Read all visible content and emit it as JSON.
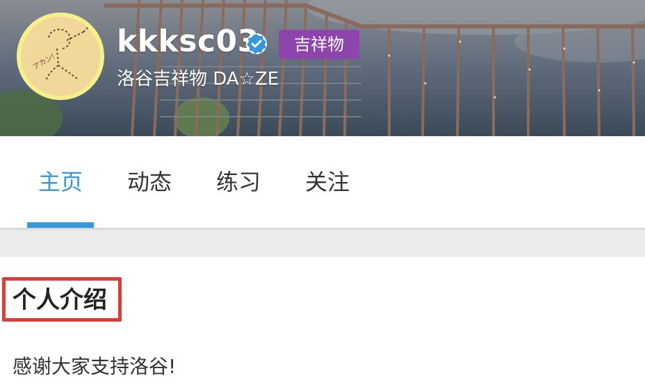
{
  "profile": {
    "username": "kkksc03",
    "badge": "吉祥物",
    "subtitle": "洛谷吉祥物 DA☆ZE",
    "verified": true,
    "badge_color": "#8e44ad",
    "verified_color": "#3498db"
  },
  "tabs": [
    {
      "label": "主页",
      "active": true
    },
    {
      "label": "动态",
      "active": false
    },
    {
      "label": "练习",
      "active": false
    },
    {
      "label": "关注",
      "active": false
    }
  ],
  "intro": {
    "title": "个人介绍",
    "text": "感谢大家支持洛谷!",
    "highlight_color": "#e53935"
  },
  "icons": {
    "verified": "verified-check-icon",
    "avatar": "sketch-avatar"
  },
  "colors": {
    "accent": "#3498db",
    "gap": "#ebebeb"
  }
}
